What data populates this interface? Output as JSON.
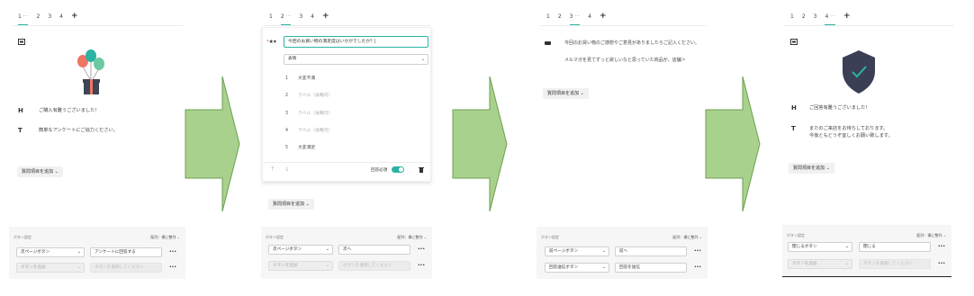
{
  "panel1": {
    "tabs": [
      "1",
      "2",
      "3",
      "4"
    ],
    "tab_active_suffix": "···",
    "heading_text": "ご購入有難うございました！",
    "body_text": "簡単なアンケートにご協力ください。",
    "add_button": "質問項目を追加",
    "settings_label": "ボタン設定",
    "sort_label": "配列：",
    "sort_value": "横に整列",
    "row1_select": "次ページボタン",
    "row1_input": "アンケートに回答する",
    "row2_select": "ボタンを追加",
    "row2_input": "ボタンを選択してください"
  },
  "panel2": {
    "tabs": [
      "1",
      "2",
      "3",
      "4"
    ],
    "question_input": "今回のお買い物の満足度はいかがでしたか？|",
    "answer_type": "表情",
    "options": [
      {
        "num": "1",
        "label": "大変不満"
      },
      {
        "num": "2",
        "label": "ラベル（省略可）"
      },
      {
        "num": "3",
        "label": "ラベル（省略可）"
      },
      {
        "num": "4",
        "label": "ラベル（省略可）"
      },
      {
        "num": "5",
        "label": "大変満足"
      }
    ],
    "required_label": "回答必須",
    "add_button": "質問項目を追加",
    "settings_label": "ボタン設定",
    "sort_label": "配列：",
    "sort_value": "横に整列",
    "row1_select": "次ページボタン",
    "row1_input": "次へ",
    "row2_select": "ボタンを追加",
    "row2_input": "ボタンを選択してください"
  },
  "panel3": {
    "tabs": [
      "1",
      "2",
      "3",
      "4"
    ],
    "body_text1": "今回のお買い物のご感想やご意見がありましたらご記入ください。",
    "body_text2": "メルマガを見てずっと欲しいなと思っていた商品が、店舗＞",
    "add_button": "質問項目を追加",
    "settings_label": "ボタン設定",
    "sort_label": "配列：",
    "sort_value": "横に整列",
    "row1_select": "前ページボタン",
    "row1_input": "前へ",
    "row2_select": "回答送信ボタン",
    "row2_input": "回答を送信"
  },
  "panel4": {
    "tabs": [
      "1",
      "2",
      "3",
      "4"
    ],
    "heading_text": "ご回答有難うございました！",
    "body_text1": "またのご来店をお待ちしております。",
    "body_text2": "今後ともどうぞ宜しくお願い致します。",
    "add_button": "質問項目を追加",
    "settings_label": "ボタン設定",
    "sort_label": "配列：",
    "sort_value": "横に整列",
    "row1_select": "閉じるボタン",
    "row1_input": "閉じる",
    "row2_select": "ボタンを追加",
    "row2_input": "ボタンを選択してください"
  },
  "icons": {
    "plus": "+",
    "heading": "H",
    "text": "T",
    "image": "image-icon",
    "dropdown": "⌄",
    "more": "···",
    "trash": "trash-icon"
  },
  "colors": {
    "accent": "#2bb3a3",
    "arrow_fill": "#a9d18e",
    "arrow_stroke": "#6e9e4f",
    "shield": "#3a3f55"
  }
}
